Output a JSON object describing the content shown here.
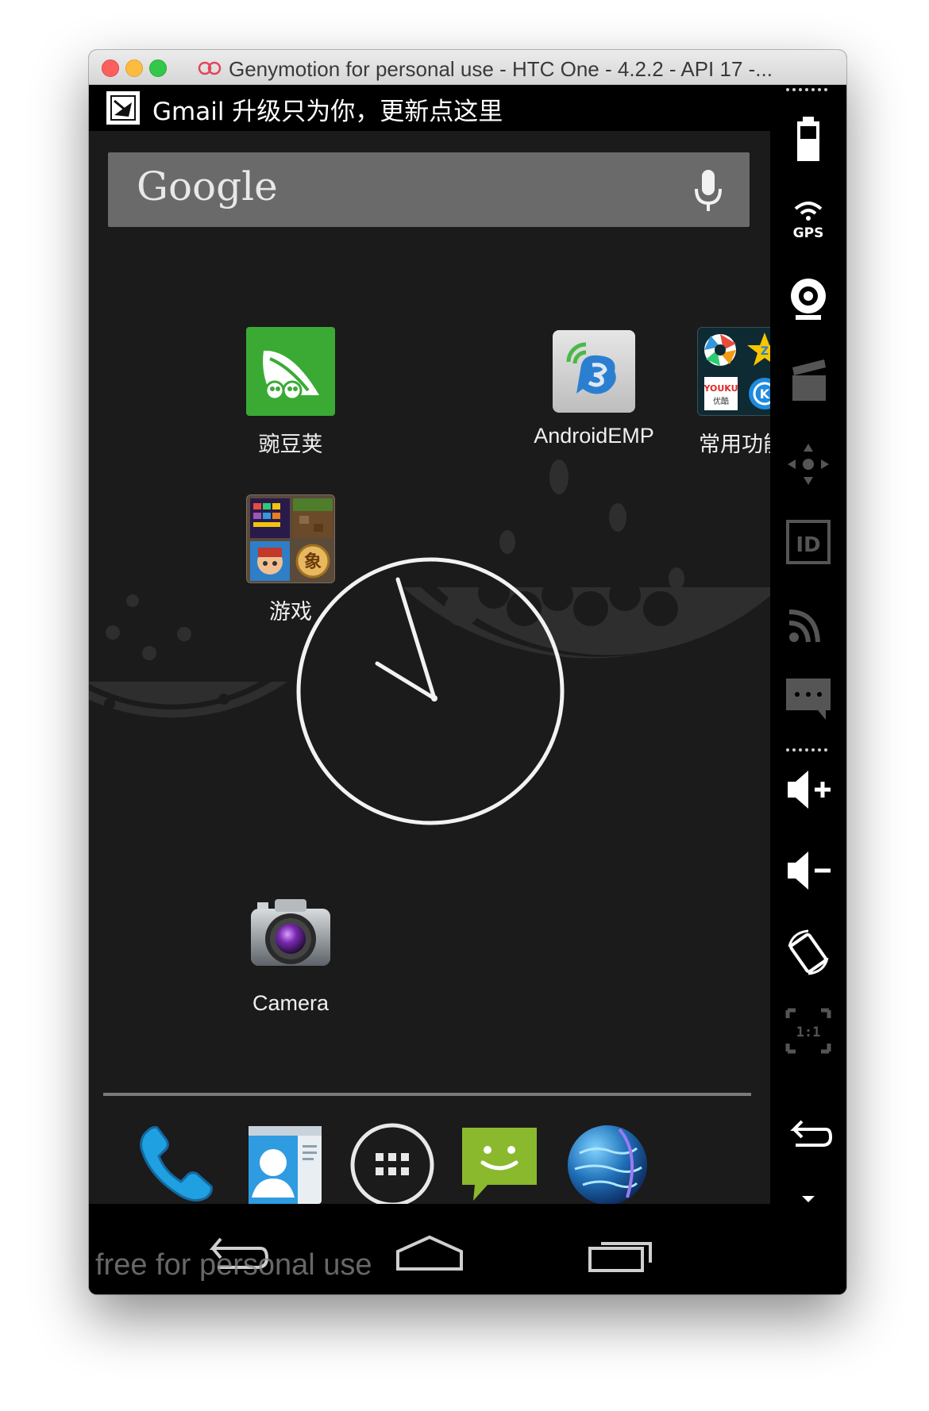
{
  "window": {
    "title": "Genymotion for personal use - HTC One - 4.2.2 - API 17 -...",
    "logo": "genymotion-logo-icon"
  },
  "statusbar": {
    "notification_icon": "market-bag-icon",
    "notification_text": "Gmail 升级只为你，更新点这里"
  },
  "search": {
    "logo_text": "Google",
    "mic_icon": "microphone-icon"
  },
  "home_apps": [
    {
      "label": "豌豆荚",
      "icon": "wandoujia-icon"
    },
    {
      "label": "AndroidEMP",
      "icon": "androidemp-icon"
    },
    {
      "label": "常用功能",
      "icon": "folder-common-icon"
    },
    {
      "label": "游戏",
      "icon": "folder-games-icon"
    },
    {
      "label": "Camera",
      "icon": "camera-icon"
    }
  ],
  "clock": {
    "type": "analog",
    "hour_hand": "about 10",
    "minute_hand": "about 58"
  },
  "dock": [
    {
      "name": "phone",
      "icon": "phone-icon"
    },
    {
      "name": "contacts",
      "icon": "contacts-icon"
    },
    {
      "name": "all-apps",
      "icon": "app-drawer-icon"
    },
    {
      "name": "messaging",
      "icon": "sms-icon"
    },
    {
      "name": "browser",
      "icon": "globe-icon"
    }
  ],
  "navbar": {
    "buttons": [
      "back-icon",
      "home-icon",
      "recent-apps-icon"
    ],
    "watermark": "free for personal use"
  },
  "sidebar": {
    "buttons": [
      "battery-icon",
      "gps-icon",
      "webcam-icon",
      "clapperboard-icon",
      "dpad-icon",
      "id-icon",
      "signal-icon",
      "sms-icon",
      "volume-up-icon",
      "volume-down-icon",
      "rotate-icon",
      "scale-1to1-icon",
      "back-icon",
      "more-icon"
    ],
    "scale_text": "1:1",
    "gps_text": "GPS",
    "id_text": "ID"
  },
  "colors": {
    "wallpaper": "#1b1b1b",
    "wallpaper_shapes": "#2e2e2e",
    "search_bar": "#6a6a6a",
    "wandoujia_green": "#3aaa35",
    "sms_green": "#8ab92d",
    "phone_blue": "#1fa0e0"
  }
}
